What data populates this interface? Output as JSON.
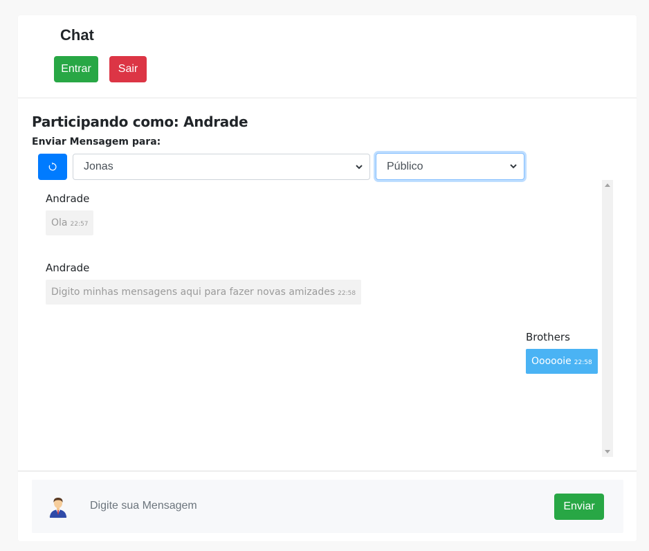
{
  "header": {
    "title": "Chat",
    "enter_label": "Entrar",
    "exit_label": "Sair"
  },
  "session": {
    "participating_text": "Participando como: Andrade",
    "send_to_label": "Enviar Mensagem para:"
  },
  "controls": {
    "refresh_icon": "refresh-icon",
    "recipient_selected": "Jonas",
    "scope_selected": "Público"
  },
  "messages": [
    {
      "author": "Andrade",
      "text": "Ola",
      "time": "22:57",
      "direction": "in"
    },
    {
      "author": "Andrade",
      "text": "Digito minhas mensagens aqui para fazer novas amizades",
      "time": "22:58",
      "direction": "in"
    },
    {
      "author": "Brothers",
      "text": "Oooooie",
      "time": "22:58",
      "direction": "out"
    }
  ],
  "composer": {
    "placeholder": "Digite sua Mensagem",
    "send_label": "Enviar",
    "avatar_icon": "user-avatar-icon"
  },
  "colors": {
    "success": "#28a745",
    "danger": "#dc3545",
    "primary": "#007bff",
    "outgoing_bubble": "#4ab3f4",
    "incoming_bubble": "#f2f2f2"
  }
}
